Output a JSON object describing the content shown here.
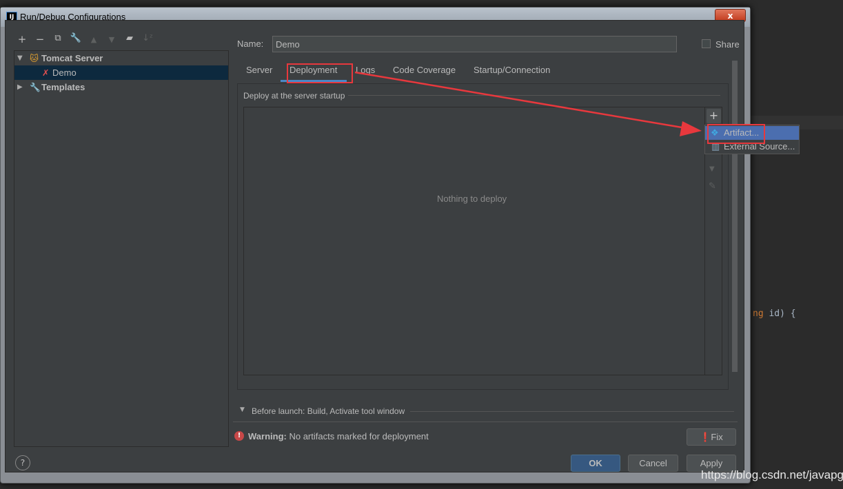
{
  "background_editor": {
    "code_fragment_keyword": "ng",
    "code_fragment_rest": " id)  {"
  },
  "window": {
    "title": "Run/Debug Configurations",
    "app_icon": "IJ",
    "close_label": "x"
  },
  "toolbar": {
    "icons": [
      "add-icon",
      "remove-icon",
      "copy-icon",
      "wrench-icon",
      "move-up-icon",
      "move-down-icon",
      "folder-add-icon",
      "sort-icon"
    ]
  },
  "tree": {
    "items": [
      {
        "label": "Tomcat Server",
        "expanded": true
      },
      {
        "label": "Demo",
        "selected": true
      },
      {
        "label": "Templates",
        "expanded": false
      }
    ]
  },
  "name": {
    "label": "Name:",
    "value": "Demo"
  },
  "share": {
    "label": "Share",
    "checked": false
  },
  "tabs": [
    {
      "label": "Server"
    },
    {
      "label": "Deployment",
      "active": true
    },
    {
      "label": "Logs"
    },
    {
      "label": "Code Coverage"
    },
    {
      "label": "Startup/Connection"
    }
  ],
  "deployment": {
    "section_title": "Deploy at the server startup",
    "empty_text": "Nothing to deploy"
  },
  "popup": {
    "items": [
      {
        "label": "Artifact...",
        "highlighted": true
      },
      {
        "label": "External Source..."
      }
    ]
  },
  "before_launch": {
    "label": "Before launch: Build, Activate tool window"
  },
  "warning": {
    "bold": "Warning:",
    "text": "No artifacts marked for deployment"
  },
  "buttons": {
    "fix": "Fix",
    "ok": "OK",
    "cancel": "Cancel",
    "apply": "Apply",
    "help": "?"
  },
  "watermark": "https://blog.csdn.net/javapg",
  "colors": {
    "annotation_red": "#e8383d",
    "accent": "#4a88c7",
    "selection": "#4b6eaf"
  }
}
